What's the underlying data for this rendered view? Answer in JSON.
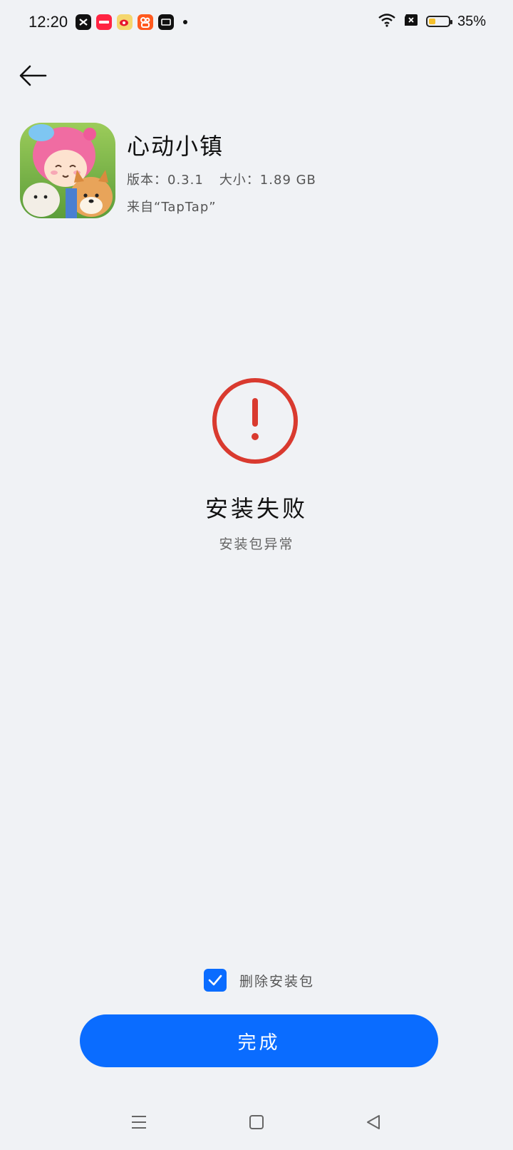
{
  "status_bar": {
    "time": "12:20",
    "battery_text": "35%",
    "battery_level": 0.35,
    "notification_icons": [
      "capcut-icon",
      "xiaohongshu-icon",
      "weibo-icon",
      "kuaishou-icon",
      "douyin-icon"
    ]
  },
  "app": {
    "name": "心动小镇",
    "version_line": "版本：0.3.1",
    "size_line": "大小：1.89 GB",
    "source_line": "来自“TapTap”"
  },
  "result": {
    "title": "安装失败",
    "subtitle": "安装包异常"
  },
  "options": {
    "delete_package_label": "删除安装包",
    "delete_package_checked": true
  },
  "actions": {
    "done_label": "完成"
  },
  "colors": {
    "accent": "#0a6cff",
    "error": "#d93a2f",
    "background": "#f0f2f5"
  }
}
